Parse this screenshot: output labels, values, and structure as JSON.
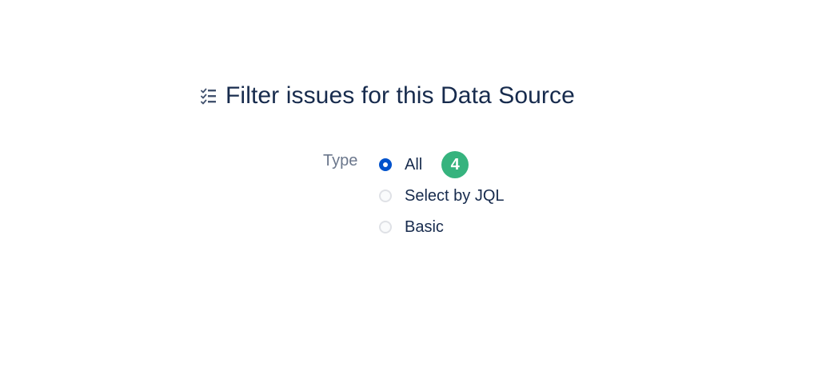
{
  "header": {
    "title": "Filter issues for this Data Source",
    "icon": "checklist-icon"
  },
  "type_field": {
    "label": "Type",
    "selected": "All",
    "options": [
      {
        "label": "All",
        "checked": true,
        "badge": "4"
      },
      {
        "label": "Select by JQL",
        "checked": false
      },
      {
        "label": "Basic",
        "checked": false
      }
    ]
  },
  "colors": {
    "title": "#172b4d",
    "label": "#6b778c",
    "radio_checked": "#0052cc",
    "radio_unchecked_border": "#dfe1e6",
    "badge": "#36b37e"
  }
}
